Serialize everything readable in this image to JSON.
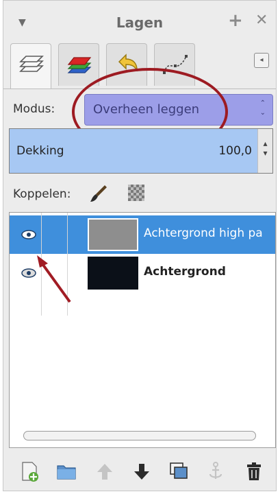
{
  "window": {
    "title": "Lagen",
    "menu_glyph": "▼",
    "add_glyph": "+",
    "close_glyph": "✕"
  },
  "tabs": [
    {
      "name": "layers-tab",
      "icon": "layers-icon",
      "active": true
    },
    {
      "name": "channels-tab",
      "icon": "channels-icon",
      "active": false
    },
    {
      "name": "undo-history-tab",
      "icon": "undo-icon",
      "active": false
    },
    {
      "name": "paths-tab",
      "icon": "paths-icon",
      "active": false
    }
  ],
  "tab_menu_glyph": "◂",
  "mode": {
    "label": "Modus:",
    "value": "Overheen leggen",
    "spin_up": "⌃",
    "spin_down": "⌄",
    "highlight_color": "#9c9ee8",
    "annotation_color": "#9d1b22"
  },
  "opacity": {
    "label": "Dekking",
    "value": "100,0",
    "fraction": 1.0,
    "fill_color": "#a7c8f3"
  },
  "link": {
    "label": "Koppelen:",
    "brush_icon": "paintbrush-icon",
    "lock_icon": "lock-alpha-icon"
  },
  "layers": [
    {
      "name": "Achtergrond high pa",
      "visible": true,
      "selected": true,
      "thumb_color": "#8e8e8e"
    },
    {
      "name": "Achtergrond",
      "visible": true,
      "selected": false,
      "thumb_color": "#0b1018"
    }
  ],
  "selection_color": "#3f8fdc",
  "toolbar": [
    {
      "name": "new-layer-button",
      "icon": "new-layer-icon"
    },
    {
      "name": "new-group-button",
      "icon": "folder-icon"
    },
    {
      "name": "raise-layer-button",
      "icon": "arrow-up-icon",
      "disabled": true
    },
    {
      "name": "lower-layer-button",
      "icon": "arrow-down-icon",
      "disabled": false
    },
    {
      "name": "duplicate-layer-button",
      "icon": "duplicate-icon"
    },
    {
      "name": "anchor-layer-button",
      "icon": "anchor-icon",
      "disabled": true
    },
    {
      "name": "delete-layer-button",
      "icon": "trash-icon"
    }
  ]
}
